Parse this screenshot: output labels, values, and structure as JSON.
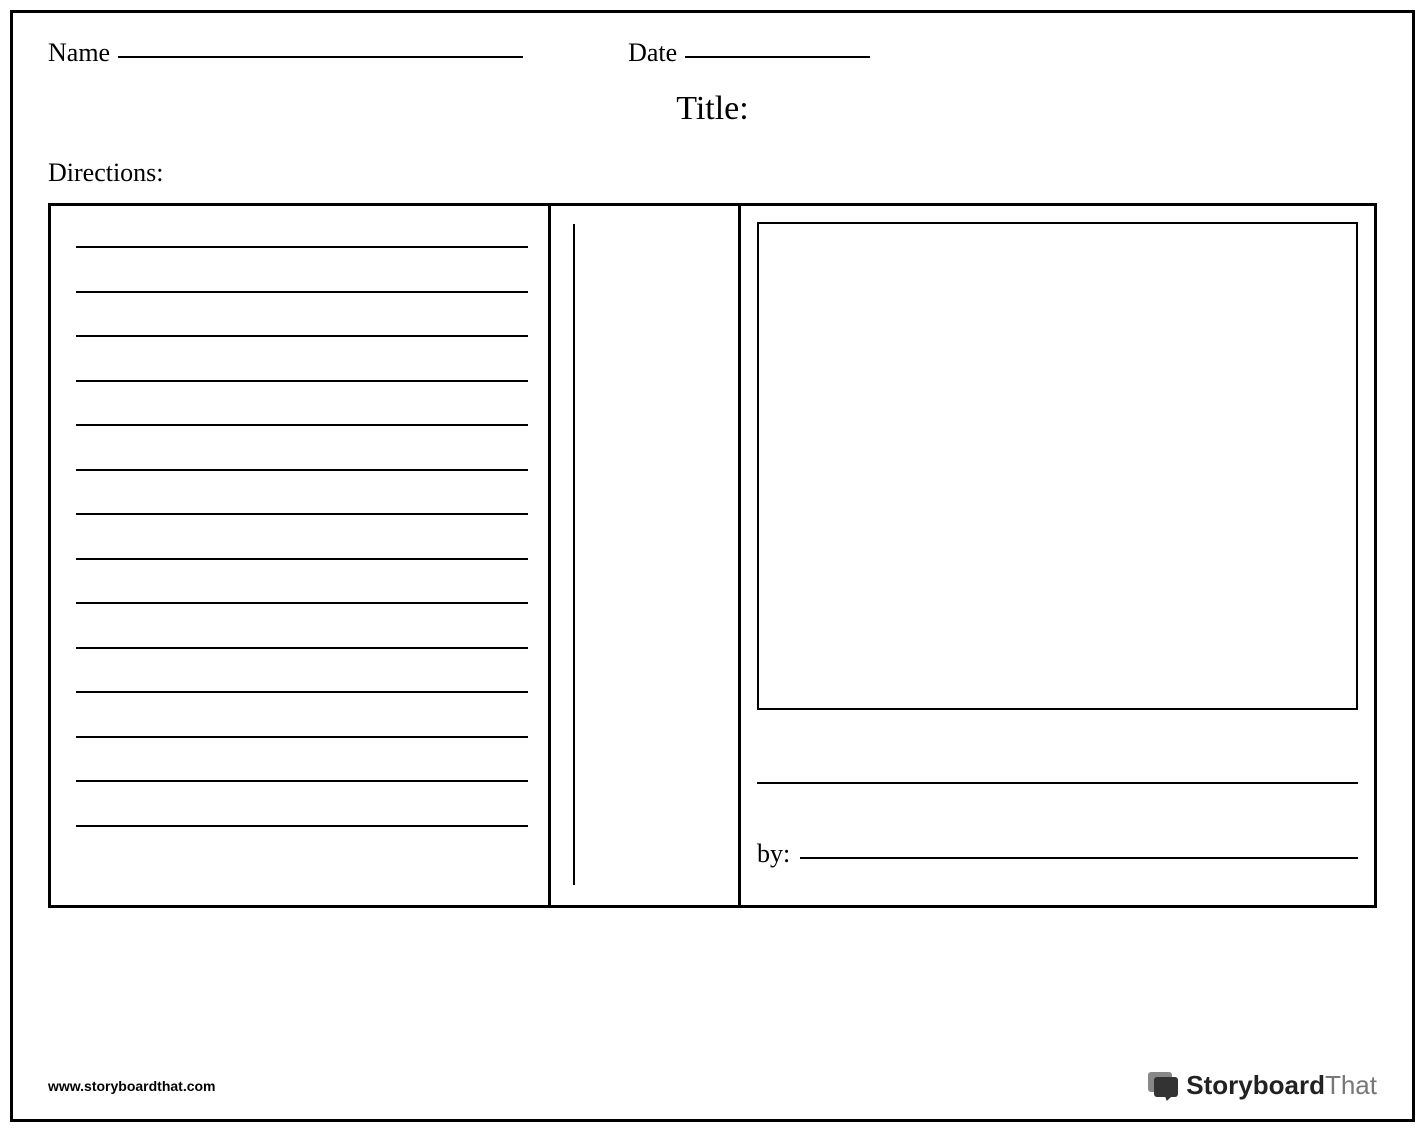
{
  "header": {
    "name_label": "Name",
    "date_label": "Date"
  },
  "title_label": "Title:",
  "directions_label": "Directions:",
  "right_panel": {
    "by_label": "by:"
  },
  "footer": {
    "url": "www.storyboardthat.com",
    "logo_bold": "Storyboard",
    "logo_thin": "That"
  },
  "writing_line_count": 14
}
